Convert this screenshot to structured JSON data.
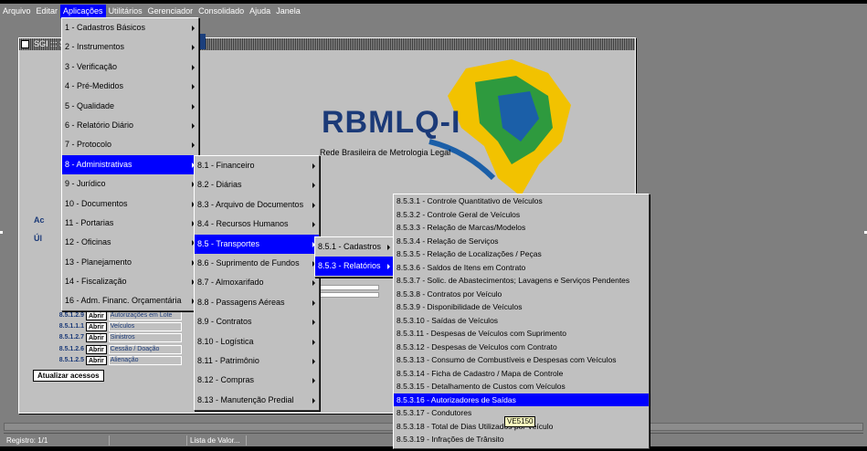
{
  "menubar": {
    "items": [
      "Arquivo",
      "Editar",
      "Aplicações",
      "Utilitários",
      "Gerenciador",
      "Consolidado",
      "Ajuda",
      "Janela"
    ],
    "active_index": 2
  },
  "window": {
    "title": "SGI ::: S"
  },
  "logo": {
    "name": "RBMLQ-I",
    "subtitle": "Rede Brasileira de Metrologia Legal"
  },
  "menu_aplicacoes": {
    "items": [
      "1 - Cadastros Básicos",
      "2 - Instrumentos",
      "3 - Verificação",
      "4 - Pré-Medidos",
      "5 - Qualidade",
      "6 - Relatório Diário",
      "7 - Protocolo",
      "8 - Administrativas",
      "9 - Jurídico",
      "10 - Documentos",
      "11 - Portarias",
      "12 - Oficinas",
      "13 - Planejamento",
      "14 - Fiscalização",
      "16 - Adm. Financ. Orçamentária"
    ],
    "selected_index": 7
  },
  "menu_administrativas": {
    "items": [
      "8.1 - Financeiro",
      "8.2 - Diárias",
      "8.3 - Arquivo de Documentos",
      "8.4 - Recursos Humanos",
      "8.5 - Transportes",
      "8.6 - Suprimento de Fundos",
      "8.7 - Almoxarifado",
      "8.8 - Passagens Aéreas",
      "8.9 - Contratos",
      "8.10 - Logística",
      "8.11 - Patrimônio",
      "8.12 - Compras",
      "8.13 - Manutenção Predial"
    ],
    "selected_index": 4
  },
  "menu_transportes": {
    "items": [
      "8.5.1 - Cadastros",
      "8.5.3 - Relatórios"
    ],
    "selected_index": 1
  },
  "menu_relatorios": {
    "items": [
      "8.5.3.1 - Controle Quantitativo de Veículos",
      "8.5.3.2 - Controle Geral de Veículos",
      "8.5.3.3 - Relação de Marcas/Modelos",
      "8.5.3.4 - Relação de Serviços",
      "8.5.3.5 - Relação de Localizações / Peças",
      "8.5.3.6 - Saldos de Itens em Contrato",
      "8.5.3.7 - Solic. de Abastecimentos; Lavagens e Serviços Pendentes",
      "8.5.3.8 - Contratos por Veículo",
      "8.5.3.9 - Disponibilidade de Veículos",
      "8.5.3.10 - Saídas de Veículos",
      "8.5.3.11 - Despesas de Veículos com Suprimento",
      "8.5.3.12 - Despesas de Veículos com Contrato",
      "8.5.3.13 - Consumo de Combustíveis e Despesas com Veículos",
      "8.5.3.14 - Ficha de Cadastro / Mapa de Controle",
      "8.5.3.15 - Detalhamento de Custos com Veículos",
      "8.5.3.16 - Autorizadores de Saídas",
      "8.5.3.17 - Condutores",
      "8.5.3.18 - Total de Dias Utilizados por Veículo",
      "8.5.3.19 - Infrações de Trânsito"
    ],
    "selected_index": 15
  },
  "tooltip": "VE5150",
  "panel": {
    "label_ac": "Ac",
    "label_ul": "Úl",
    "rows": [
      {
        "code": "8.5.1.2.9",
        "button": "Abrir",
        "field": "Autorizações em Lote"
      },
      {
        "code": "8.5.1.1.1",
        "button": "Abrir",
        "field": "Veículos"
      },
      {
        "code": "8.5.1.2.7",
        "button": "Abrir",
        "field": "Sinistros"
      },
      {
        "code": "8.5.1.2.6",
        "button": "Abrir",
        "field": "Cessão / Doação"
      },
      {
        "code": "8.5.1.2.5",
        "button": "Abrir",
        "field": "Alienação"
      }
    ],
    "update_button": "Atualizar acessos"
  },
  "statusbar": {
    "record": "Registro: 1/1",
    "lov": "Lista de Valor..."
  }
}
